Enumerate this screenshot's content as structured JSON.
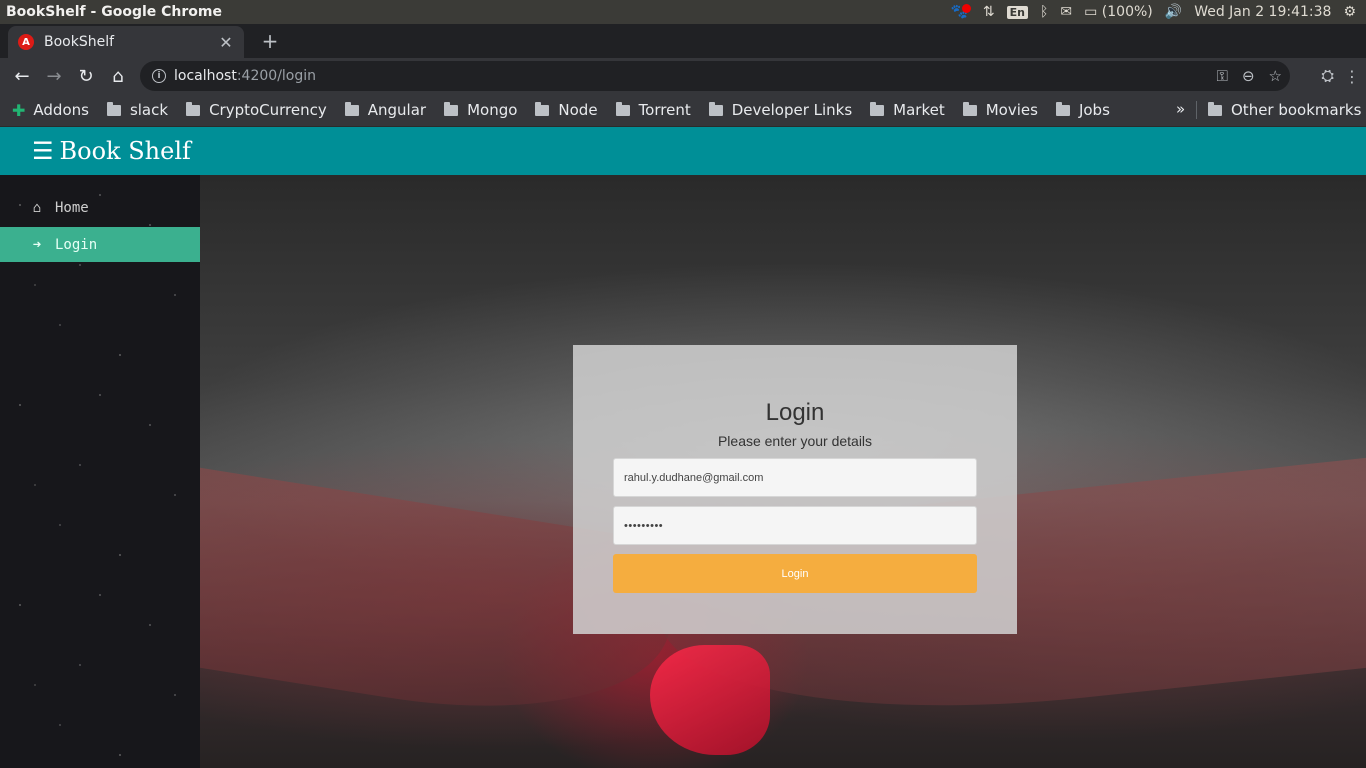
{
  "os": {
    "window_title": "BookShelf - Google Chrome",
    "battery": "(100%)",
    "datetime": "Wed Jan  2 19:41:38",
    "lang": "En"
  },
  "browser": {
    "tab_title": "BookShelf",
    "url_host": "localhost",
    "url_path": ":4200/login",
    "bookmarks": [
      "Addons",
      "slack",
      "CryptoCurrency",
      "Angular",
      "Mongo",
      "Node",
      "Torrent",
      "Developer Links",
      "Market",
      "Movies",
      "Jobs"
    ],
    "other_bookmarks": "Other bookmarks",
    "overflow": "»"
  },
  "app": {
    "menu_icon": "☰",
    "title": "Book Shelf",
    "sidebar": [
      {
        "label": "Home",
        "icon": "home-icon"
      },
      {
        "label": "Login",
        "icon": "sign-in-icon"
      }
    ],
    "login": {
      "title": "Login",
      "subtitle": "Please enter your details",
      "email_value": "rahul.y.dudhane@gmail.com",
      "password_value": "•••••••••",
      "button_label": "Login"
    },
    "colors": {
      "header": "#008f97",
      "sidebar_active": "#3bb08f",
      "login_button": "#f5ad3f"
    }
  }
}
